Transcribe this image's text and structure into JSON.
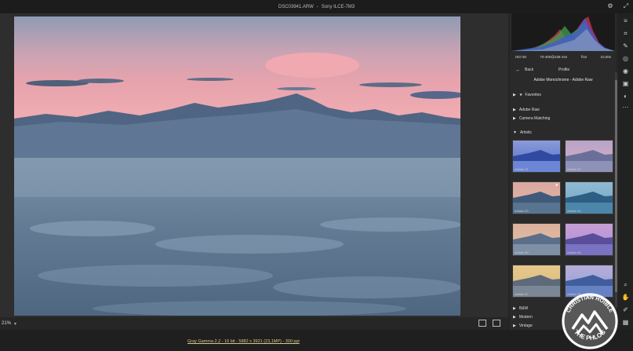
{
  "titlebar": {
    "filename": "DSC03941.ARW",
    "separator": "-",
    "camera": "Sony ILCE-7M3"
  },
  "camera_info": {
    "iso": "ISO 50",
    "lens": "70-300@238 mm",
    "aperture": "f/10",
    "shutter": "10,00s"
  },
  "profile": {
    "back_label": "Back",
    "title": "Profile",
    "current": "Adobe Monochrome - Adobe Raw"
  },
  "groups": {
    "favorites": "Favorites",
    "adobe_raw": "Adobe Raw",
    "camera_matching": "Camera Matching",
    "artistic": "Artistic",
    "bw": "B&W",
    "modern": "Modern",
    "vintage": "Vintage"
  },
  "thumbnails": [
    {
      "label": "Artistic 01"
    },
    {
      "label": "Artistic 02"
    },
    {
      "label": "Artistic 03"
    },
    {
      "label": "Artistic 04"
    },
    {
      "label": "Artistic 05"
    },
    {
      "label": "Artistic 06"
    },
    {
      "label": "Artistic 07"
    },
    {
      "label": "Artistic 08"
    }
  ],
  "zoom": {
    "value": "21%"
  },
  "workflow_info": "Gray Gamma 2.2 - 16 bit - 5882 x 3921 (23,1MP) - 300 ppi",
  "logo": {
    "top_text": "CHRISTIAN HOIBLE",
    "bottom_text": "THE PHLOG"
  },
  "colors": {
    "accent_link": "#d8c88a",
    "panel_bg": "#2a2a2a"
  }
}
